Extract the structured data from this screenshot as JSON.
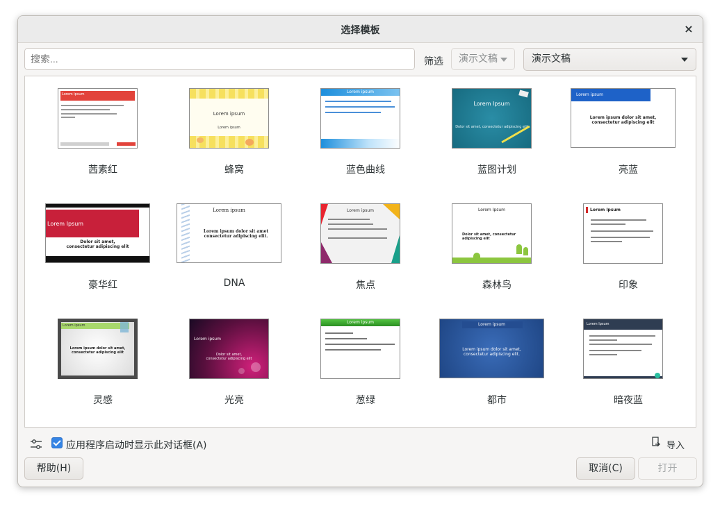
{
  "dialog": {
    "title": "选择模板",
    "close_glyph": "×"
  },
  "search": {
    "placeholder": "搜索..."
  },
  "filter": {
    "label": "筛选",
    "category_value": "演示文稿",
    "type_value": "演示文稿"
  },
  "templates": [
    {
      "name": "茜素红",
      "sample": "Lorem ipsum",
      "accent": "#e2433b"
    },
    {
      "name": "蜂窝",
      "sample": "Lorem ipsum",
      "accent": "#f7e15a"
    },
    {
      "name": "蓝色曲线",
      "sample": "Lorem ipsum",
      "accent": "#1e8fdc"
    },
    {
      "name": "蓝图计划",
      "sample": "Lorem Ipsum",
      "accent": "#1f7f96"
    },
    {
      "name": "亮蓝",
      "sample": "Lorem ipsum",
      "accent": "#1e62c8"
    },
    {
      "name": "豪华红",
      "sample": "Lorem Ipsum",
      "accent": "#c8203a"
    },
    {
      "name": "DNA",
      "sample": "Lorem ipsum",
      "accent": "#8fb4da"
    },
    {
      "name": "焦点",
      "sample": "Lorem ipsum",
      "accent": "#f2b31a"
    },
    {
      "name": "森林鸟",
      "sample": "Lorem Ipsum",
      "accent": "#8cc63f"
    },
    {
      "name": "印象",
      "sample": "Lorem Ipsum",
      "accent": "#d22a2a"
    },
    {
      "name": "灵感",
      "sample": "Lorem ipsum",
      "accent": "#a8d86c"
    },
    {
      "name": "光亮",
      "sample": "Lorem ipsum",
      "accent": "#a2165c"
    },
    {
      "name": "葱绿",
      "sample": "Lorem ipsum",
      "accent": "#3aa52b"
    },
    {
      "name": "都市",
      "sample": "Lorem ipsum",
      "accent": "#244d91"
    },
    {
      "name": "暗夜蓝",
      "sample": "Lorem Ipsum",
      "accent": "#2f3d52"
    }
  ],
  "footer": {
    "show_on_startup_label": "应用程序启动时显示此对话框(A)",
    "show_on_startup_checked": true,
    "import_label": "导入",
    "help_button": "帮助(H)",
    "cancel_button": "取消(C)",
    "open_button": "打开"
  }
}
